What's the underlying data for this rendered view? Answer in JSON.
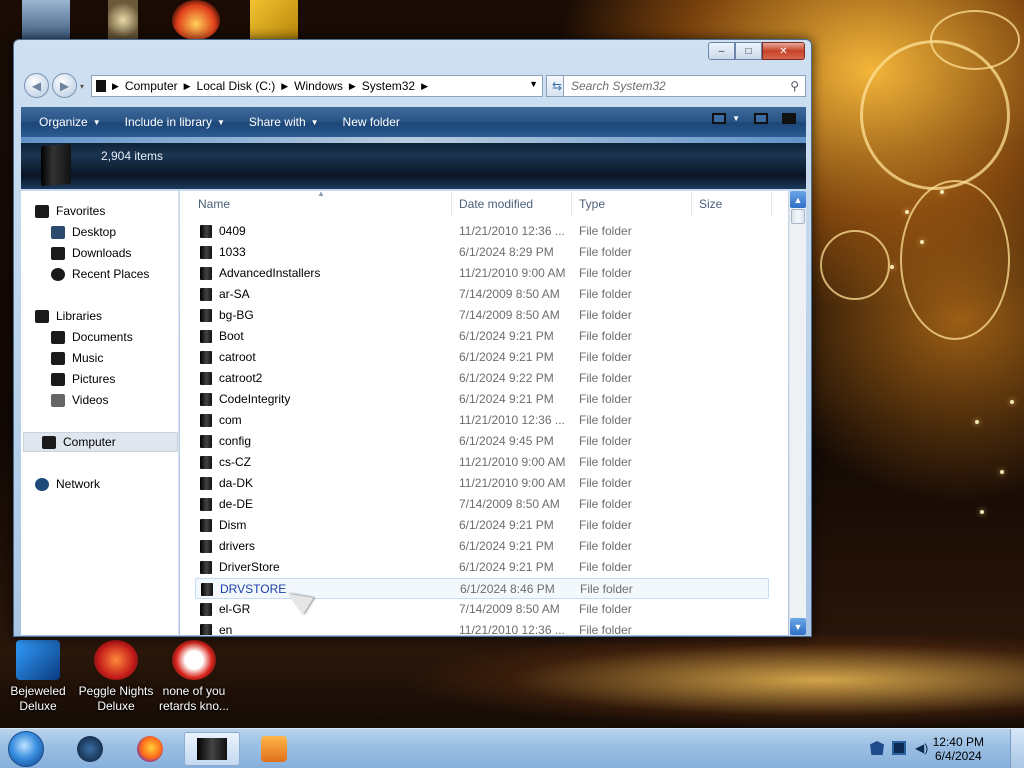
{
  "desktop": {
    "icons": [
      {
        "label": "Bejeweled\nDeluxe",
        "line1": "Bejeweled",
        "line2": "Deluxe"
      },
      {
        "label": "Peggle Nights\nDeluxe",
        "line1": "Peggle Nights",
        "line2": "Deluxe"
      },
      {
        "label": "none of you\nretards kno...",
        "line1": "none of you",
        "line2": "retards kno..."
      }
    ]
  },
  "window": {
    "controls": {
      "minimize": "–",
      "maximize": "□",
      "close": "✕"
    },
    "address": {
      "crumbs": [
        "Computer",
        "Local Disk (C:)",
        "Windows",
        "System32"
      ]
    },
    "search": {
      "placeholder": "Search System32"
    },
    "toolbar": {
      "organize": "Organize",
      "include_in_library": "Include in library",
      "share_with": "Share with",
      "new_folder": "New folder"
    },
    "banner": {
      "item_count": "2,904 items"
    },
    "nav": {
      "favorites": "Favorites",
      "desktop": "Desktop",
      "downloads": "Downloads",
      "recent_places": "Recent Places",
      "libraries": "Libraries",
      "documents": "Documents",
      "music": "Music",
      "pictures": "Pictures",
      "videos": "Videos",
      "computer": "Computer",
      "network": "Network"
    },
    "columns": {
      "name": "Name",
      "date": "Date modified",
      "type": "Type",
      "size": "Size"
    },
    "rows": [
      {
        "name": "0409",
        "date": "11/21/2010 12:36 ...",
        "type": "File folder"
      },
      {
        "name": "1033",
        "date": "6/1/2024 8:29 PM",
        "type": "File folder"
      },
      {
        "name": "AdvancedInstallers",
        "date": "11/21/2010 9:00 AM",
        "type": "File folder"
      },
      {
        "name": "ar-SA",
        "date": "7/14/2009 8:50 AM",
        "type": "File folder"
      },
      {
        "name": "bg-BG",
        "date": "7/14/2009 8:50 AM",
        "type": "File folder"
      },
      {
        "name": "Boot",
        "date": "6/1/2024 9:21 PM",
        "type": "File folder"
      },
      {
        "name": "catroot",
        "date": "6/1/2024 9:21 PM",
        "type": "File folder"
      },
      {
        "name": "catroot2",
        "date": "6/1/2024 9:22 PM",
        "type": "File folder"
      },
      {
        "name": "CodeIntegrity",
        "date": "6/1/2024 9:21 PM",
        "type": "File folder"
      },
      {
        "name": "com",
        "date": "11/21/2010 12:36 ...",
        "type": "File folder"
      },
      {
        "name": "config",
        "date": "6/1/2024 9:45 PM",
        "type": "File folder"
      },
      {
        "name": "cs-CZ",
        "date": "11/21/2010 9:00 AM",
        "type": "File folder"
      },
      {
        "name": "da-DK",
        "date": "11/21/2010 9:00 AM",
        "type": "File folder"
      },
      {
        "name": "de-DE",
        "date": "7/14/2009 8:50 AM",
        "type": "File folder"
      },
      {
        "name": "Dism",
        "date": "6/1/2024 9:21 PM",
        "type": "File folder"
      },
      {
        "name": "drivers",
        "date": "6/1/2024 9:21 PM",
        "type": "File folder"
      },
      {
        "name": "DriverStore",
        "date": "6/1/2024 9:21 PM",
        "type": "File folder"
      },
      {
        "name": "DRVSTORE",
        "date": "6/1/2024 8:46 PM",
        "type": "File folder",
        "selected": true
      },
      {
        "name": "el-GR",
        "date": "7/14/2009 8:50 AM",
        "type": "File folder"
      },
      {
        "name": "en",
        "date": "11/21/2010 12:36 ...",
        "type": "File folder"
      }
    ]
  },
  "taskbar": {
    "time": "12:40 PM",
    "date": "6/4/2024"
  },
  "colors": {
    "toolbar": "#2a5587",
    "selection": "#c5dcf2",
    "selected_text": "#1a3fa8",
    "taskbar": "#9cc0e4"
  }
}
